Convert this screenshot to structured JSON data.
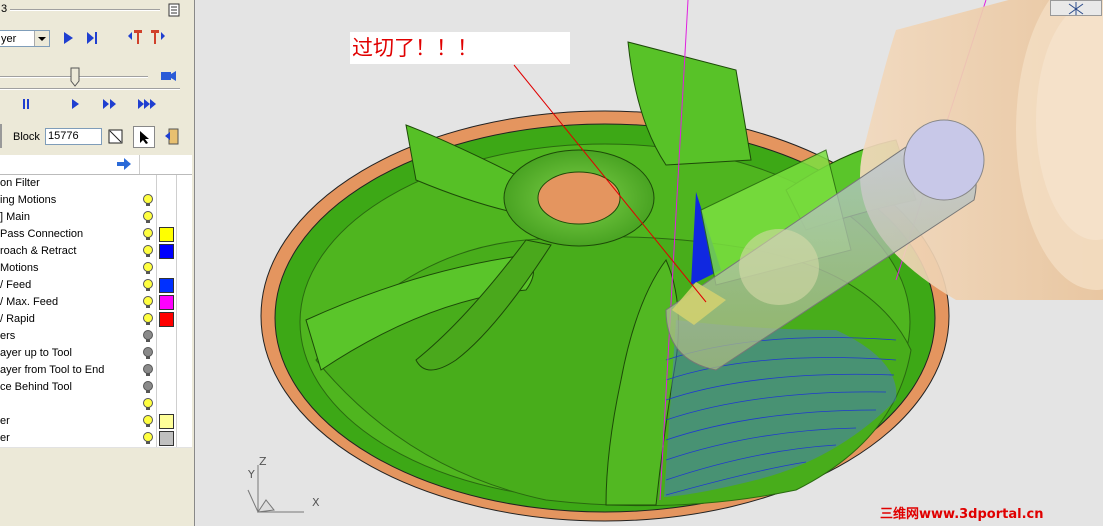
{
  "toolbar": {
    "number_fragment": "3",
    "layer_select_value": "yer",
    "block_label": "Block",
    "block_value": "15776"
  },
  "tree": {
    "items": [
      {
        "label": "on Filter",
        "bulb": false
      },
      {
        "label": "ing Motions",
        "bulb": true,
        "bulb_color": "#ffff40"
      },
      {
        "label": "] Main",
        "bulb": true,
        "bulb_color": "#ffff40"
      },
      {
        "label": "Pass Connection",
        "bulb": true,
        "bulb_color": "#ffff40",
        "swatch": "#ffff00"
      },
      {
        "label": "roach & Retract",
        "bulb": true,
        "bulb_color": "#ffff40",
        "swatch": "#0000ff"
      },
      {
        "label": "Motions",
        "bulb": true,
        "bulb_color": "#ffff40"
      },
      {
        "label": "/ Feed",
        "bulb": true,
        "bulb_color": "#ffff40",
        "swatch": "#0030ff"
      },
      {
        "label": "/ Max. Feed",
        "bulb": true,
        "bulb_color": "#ffff40",
        "swatch": "#ff00ff"
      },
      {
        "label": "/ Rapid",
        "bulb": true,
        "bulb_color": "#ffff40",
        "swatch": "#ff0000"
      },
      {
        "label": "ers",
        "bulb": true,
        "bulb_color": "#8a8a8a"
      },
      {
        "label": "ayer up to Tool",
        "bulb": true,
        "bulb_color": "#8a8a8a"
      },
      {
        "label": "ayer from Tool to End",
        "bulb": true,
        "bulb_color": "#8a8a8a"
      },
      {
        "label": "ce Behind Tool",
        "bulb": true,
        "bulb_color": "#8a8a8a"
      },
      {
        "label": "",
        "bulb": true,
        "bulb_color": "#ffff40"
      },
      {
        "label": "er",
        "bulb": true,
        "bulb_color": "#ffff40",
        "swatch": "#ffff99"
      },
      {
        "label": "er",
        "bulb": true,
        "bulb_color": "#ffff40",
        "swatch": "#c0c0c0"
      }
    ]
  },
  "viewport": {
    "annotation": "过切了！！！",
    "axis_z": "Z",
    "axis_y": "Y",
    "axis_x": "X",
    "watermark": "三维网www.3dportal.cn"
  },
  "icons": [
    "properties-icon",
    "play-icon",
    "step-end-icon",
    "prev-marker-icon",
    "next-marker-icon",
    "camera-icon",
    "pause-icon",
    "step-forward-icon",
    "fast-forward-icon",
    "fastest-forward-icon",
    "zoom-box-icon",
    "pointer-icon",
    "exit-icon",
    "arrow-right-icon",
    "bulb-icon",
    "view-axis-icon"
  ]
}
